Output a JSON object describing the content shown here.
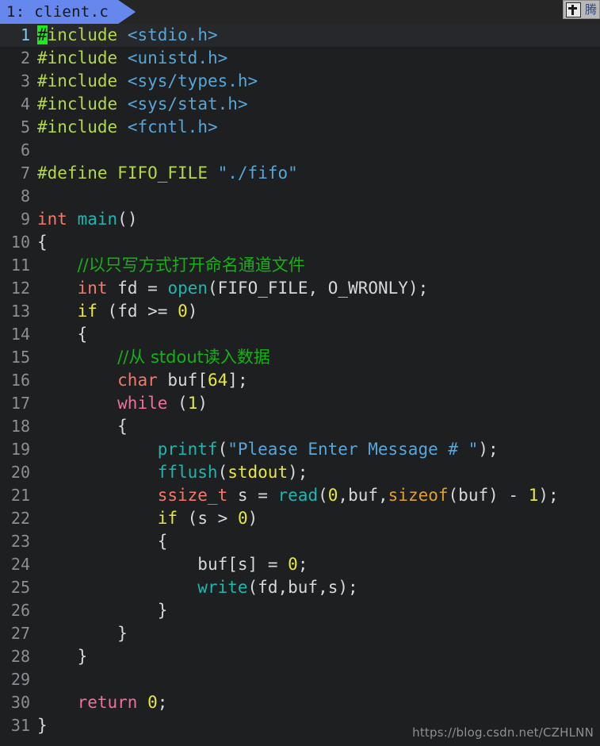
{
  "tab": {
    "label": "1: client.c",
    "index": "1",
    "filename": "client.c"
  },
  "ime_widget": {
    "pin_icon": "pin-icon",
    "label": "腾"
  },
  "editor": {
    "cursor_line": 1,
    "cursor_char": "#",
    "colors": {
      "background": "#1d1f21",
      "current_line_bg": "#26282b",
      "tab_bg": "#6688ee",
      "tabbar_bg": "#252525",
      "linenum": "#8a8f93",
      "linenum_active": "#7ec8f0",
      "preprocessor": "#b5d84a",
      "header": "#58a6d8",
      "string": "#58a6d8",
      "type": "#f4796b",
      "function": "#1eb6ae",
      "keyword_if": "#e8e83c",
      "keyword_loop": "#ef6ea0",
      "number": "#e8e83c",
      "comment": "#17b017",
      "sizeof": "#e0a030",
      "plain": "#d6d8d9",
      "cursor": "#1ee81e"
    },
    "lines": [
      {
        "n": "1",
        "text": "#include <stdio.h>"
      },
      {
        "n": "2",
        "text": "#include <unistd.h>"
      },
      {
        "n": "3",
        "text": "#include <sys/types.h>"
      },
      {
        "n": "4",
        "text": "#include <sys/stat.h>"
      },
      {
        "n": "5",
        "text": "#include <fcntl.h>"
      },
      {
        "n": "6",
        "text": ""
      },
      {
        "n": "7",
        "text": "#define FIFO_FILE \"./fifo\""
      },
      {
        "n": "8",
        "text": ""
      },
      {
        "n": "9",
        "text": "int main()"
      },
      {
        "n": "10",
        "text": "{"
      },
      {
        "n": "11",
        "text": "    //以只写方式打开命名通道文件"
      },
      {
        "n": "12",
        "text": "    int fd = open(FIFO_FILE, O_WRONLY);"
      },
      {
        "n": "13",
        "text": "    if (fd >= 0)"
      },
      {
        "n": "14",
        "text": "    {"
      },
      {
        "n": "15",
        "text": "        //从 stdout读入数据"
      },
      {
        "n": "16",
        "text": "        char buf[64];"
      },
      {
        "n": "17",
        "text": "        while (1)"
      },
      {
        "n": "18",
        "text": "        {"
      },
      {
        "n": "19",
        "text": "            printf(\"Please Enter Message # \");"
      },
      {
        "n": "20",
        "text": "            fflush(stdout);"
      },
      {
        "n": "21",
        "text": "            ssize_t s = read(0,buf,sizeof(buf) - 1);"
      },
      {
        "n": "22",
        "text": "            if (s > 0)"
      },
      {
        "n": "23",
        "text": "            {"
      },
      {
        "n": "24",
        "text": "                buf[s] = 0;"
      },
      {
        "n": "25",
        "text": "                write(fd,buf,s);"
      },
      {
        "n": "26",
        "text": "            }"
      },
      {
        "n": "27",
        "text": "        }"
      },
      {
        "n": "28",
        "text": "    }"
      },
      {
        "n": "29",
        "text": ""
      },
      {
        "n": "30",
        "text": "    return 0;"
      },
      {
        "n": "31",
        "text": "}"
      }
    ]
  },
  "watermark": {
    "text": "https://blog.csdn.net/CZHLNN"
  }
}
